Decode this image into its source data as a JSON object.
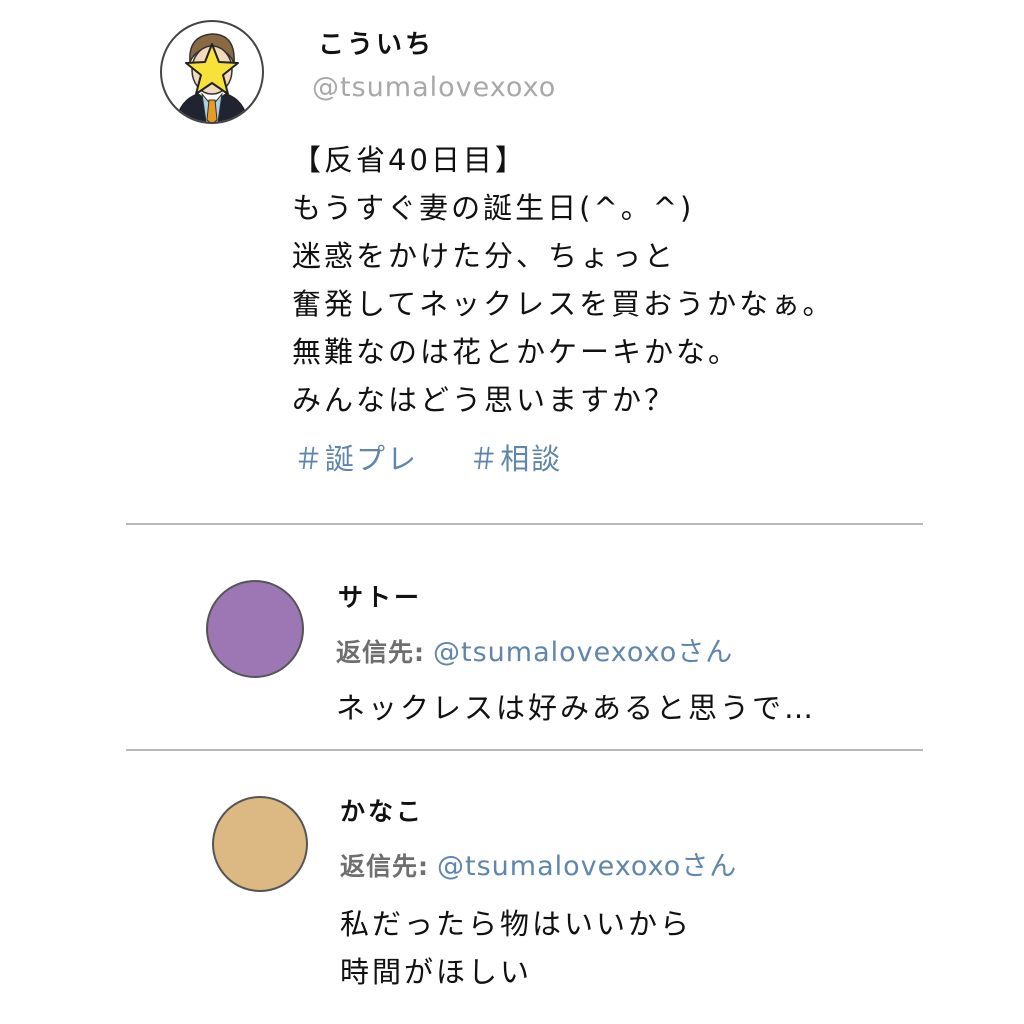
{
  "post": {
    "author_name": "こういち",
    "author_handle": "@tsumalovexoxo",
    "avatar_icon": "masked-man-avatar-icon",
    "body_lines": [
      "【反省40日目】",
      "もうすぐ妻の誕生日(^。^)",
      "迷惑をかけた分、ちょっと",
      "奮発してネックレスを買おうかなぁ。",
      "無難なのは花とかケーキかな。",
      "みんなはどう思いますか？"
    ],
    "hashtags": [
      "＃誕プレ",
      "＃相談"
    ]
  },
  "replies": [
    {
      "author_name": "サトー",
      "reply_label": "返信先:",
      "reply_to": "@tsumalovexoxoさん",
      "avatar_color": "#9d76b4",
      "text_lines": [
        "ネックレスは好みあると思うで…"
      ]
    },
    {
      "author_name": "かなこ",
      "reply_label": "返信先:",
      "reply_to": "@tsumalovexoxoさん",
      "avatar_color": "#dcb982",
      "text_lines": [
        "私だったら物はいいから",
        "時間がほしい"
      ]
    }
  ],
  "colors": {
    "hashtag": "#5f86ad",
    "handle": "#a8a8a8",
    "divider": "#b8b8b8"
  }
}
